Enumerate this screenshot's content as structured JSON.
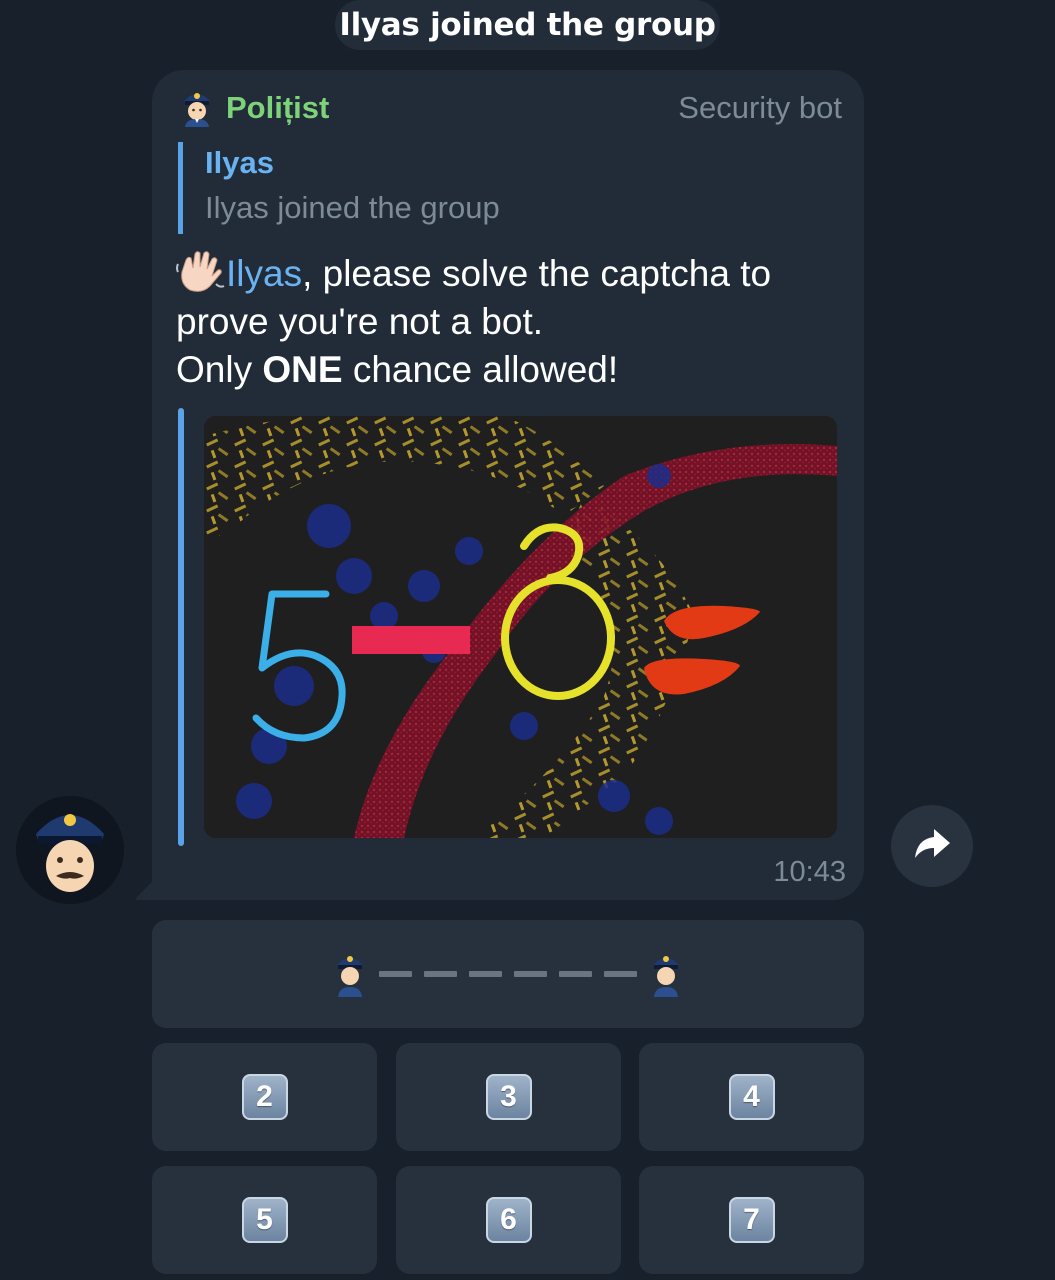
{
  "service_message": "Ilyas joined the group",
  "message": {
    "sender_name": "Polițist",
    "sender_role": "Security bot",
    "reply": {
      "name": "Ilyas",
      "text": "Ilyas joined the group"
    },
    "text_mention": "Ilyas",
    "text_part1": ", please solve the captcha to",
    "text_part2": "prove you're not a bot.",
    "text_only": "Only ",
    "text_bold": "ONE",
    "text_part3": " chance allowed!",
    "time": "10:43",
    "captcha_characters": [
      "5",
      "3"
    ]
  },
  "keyboard": {
    "answer_buttons": [
      {
        "label": "2"
      },
      {
        "label": "3"
      },
      {
        "label": "4"
      },
      {
        "label": "5"
      },
      {
        "label": "6"
      },
      {
        "label": "7"
      }
    ]
  },
  "icons": {
    "sender": "police-officer-emoji",
    "wave": "waving-hand-emoji",
    "forward": "forward-arrow-icon",
    "avatar": "police-officer-face"
  },
  "colors": {
    "background": "#18202b",
    "bubble": "#222c38",
    "sender_name": "#7ed37a",
    "link": "#6ab3f3",
    "muted": "#7d8b99",
    "button": "#27313d"
  }
}
